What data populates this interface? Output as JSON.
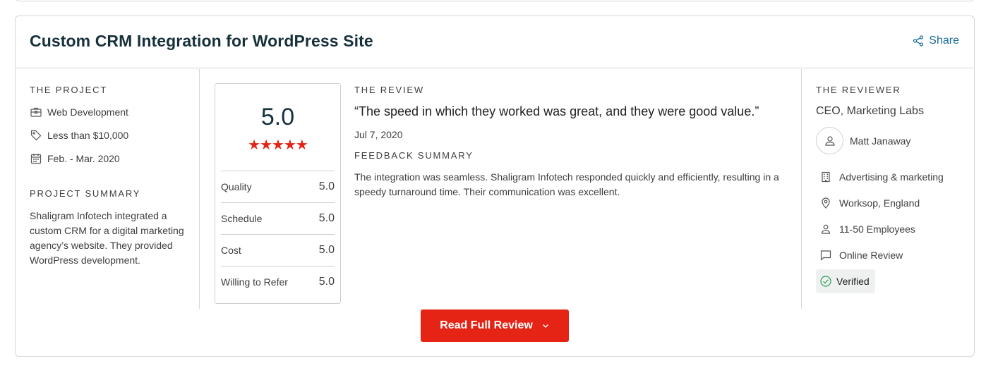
{
  "card": {
    "title": "Custom CRM Integration for WordPress Site",
    "share_label": "Share"
  },
  "project": {
    "section_label": "THE PROJECT",
    "service": "Web Development",
    "budget": "Less than $10,000",
    "dates": "Feb. - Mar. 2020",
    "summary_label": "PROJECT SUMMARY",
    "summary": "Shaligram Infotech integrated a custom CRM for a digital marketing agency’s website. They provided WordPress development."
  },
  "rating": {
    "overall": "5.0",
    "stars": "★★★★★",
    "star_count": 5,
    "rows": [
      {
        "label": "Quality",
        "value": "5.0"
      },
      {
        "label": "Schedule",
        "value": "5.0"
      },
      {
        "label": "Cost",
        "value": "5.0"
      },
      {
        "label": "Willing to Refer",
        "value": "5.0"
      }
    ]
  },
  "review": {
    "section_label": "THE REVIEW",
    "quote": "“The speed in which they worked was great, and they were good value.”",
    "date": "Jul 7, 2020",
    "feedback_label": "FEEDBACK SUMMARY",
    "feedback": "The integration was seamless. Shaligram Infotech responded quickly and efficiently, resulting in a speedy turnaround time. Their communication was excellent."
  },
  "reviewer": {
    "section_label": "THE REVIEWER",
    "title": "CEO, Marketing Labs",
    "name": "Matt Janaway",
    "industry": "Advertising & marketing",
    "location": "Worksop, England",
    "size": "11-50 Employees",
    "review_type": "Online Review",
    "verified": "Verified"
  },
  "button": {
    "label": "Read Full Review"
  },
  "colors": {
    "accent": "#e62415",
    "title": "#17313b",
    "link": "#1a6d9c",
    "verified_check": "#2e9e5b"
  }
}
